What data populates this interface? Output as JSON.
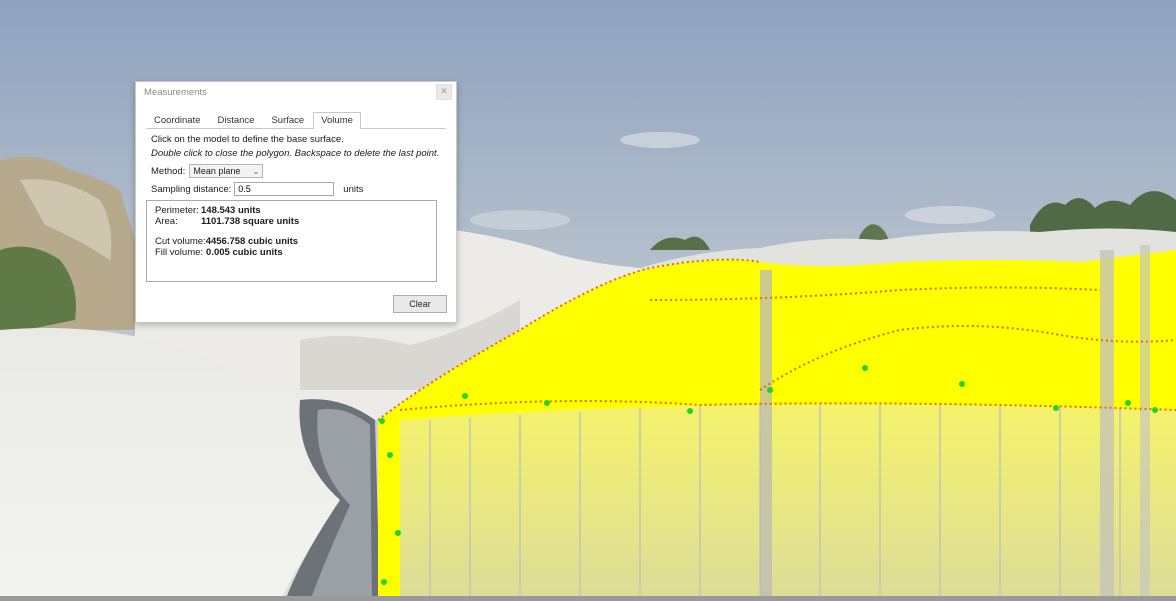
{
  "window": {
    "title": "Measurements"
  },
  "tabs": [
    {
      "label": "Coordinate",
      "active": false
    },
    {
      "label": "Distance",
      "active": false
    },
    {
      "label": "Surface",
      "active": false
    },
    {
      "label": "Volume",
      "active": true
    }
  ],
  "volume_tab": {
    "instruction": "Click on the model to define the base surface.",
    "hint": "Double click to close the polygon. Backspace to delete the last point.",
    "method_label": "Method:",
    "method_value": "Mean plane",
    "sampling_label": "Sampling distance:",
    "sampling_value": "0.5",
    "sampling_units": "units",
    "results": {
      "perimeter_label": "Perimeter:",
      "perimeter_value": "148.543 units",
      "area_label": "Area:",
      "area_value": "1101.738 square units",
      "cut_label": "Cut volume:",
      "cut_value": "4456.758 cubic units",
      "fill_label": "Fill volume:",
      "fill_value": "0.005 cubic units"
    },
    "clear_label": "Clear"
  },
  "scene": {
    "description_colors": {
      "sky_top": "#94a6c0",
      "sky_bottom": "#dcdfdf",
      "volume_fill": "#ffff00",
      "sample_points": "#e06a1a",
      "polygon_vertices": "#22d12a"
    }
  }
}
